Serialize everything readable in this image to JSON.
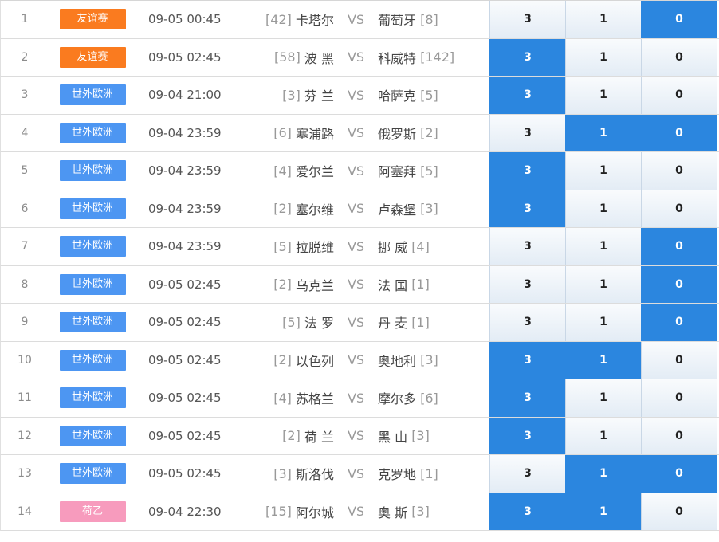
{
  "colors": {
    "league_friendly": "#fa7b1f",
    "league_wcq_europe": "#4d96f2",
    "league_eerste_divisie": "#f79bbd",
    "selected_option": "#2b86df"
  },
  "vs_label": "VS",
  "matches": [
    {
      "num": "1",
      "league": "友谊赛",
      "league_color": "#fa7b1f",
      "time": "09-05 00:45",
      "home_rank": "[42]",
      "home": "卡塔尔",
      "away": "葡萄牙",
      "away_rank": "[8]",
      "options": [
        {
          "label": "3",
          "selected": false
        },
        {
          "label": "1",
          "selected": false
        },
        {
          "label": "0",
          "selected": true
        }
      ]
    },
    {
      "num": "2",
      "league": "友谊赛",
      "league_color": "#fa7b1f",
      "time": "09-05 02:45",
      "home_rank": "[58]",
      "home": "波 黑",
      "away": "科威特",
      "away_rank": "[142]",
      "options": [
        {
          "label": "3",
          "selected": true
        },
        {
          "label": "1",
          "selected": false
        },
        {
          "label": "0",
          "selected": false
        }
      ]
    },
    {
      "num": "3",
      "league": "世外欧洲",
      "league_color": "#4d96f2",
      "time": "09-04 21:00",
      "home_rank": "[3]",
      "home": "芬 兰",
      "away": "哈萨克",
      "away_rank": "[5]",
      "options": [
        {
          "label": "3",
          "selected": true
        },
        {
          "label": "1",
          "selected": false
        },
        {
          "label": "0",
          "selected": false
        }
      ]
    },
    {
      "num": "4",
      "league": "世外欧洲",
      "league_color": "#4d96f2",
      "time": "09-04 23:59",
      "home_rank": "[6]",
      "home": "塞浦路",
      "away": "俄罗斯",
      "away_rank": "[2]",
      "options": [
        {
          "label": "3",
          "selected": false
        },
        {
          "label": "1",
          "selected": true
        },
        {
          "label": "0",
          "selected": true
        }
      ]
    },
    {
      "num": "5",
      "league": "世外欧洲",
      "league_color": "#4d96f2",
      "time": "09-04 23:59",
      "home_rank": "[4]",
      "home": "爱尔兰",
      "away": "阿塞拜",
      "away_rank": "[5]",
      "options": [
        {
          "label": "3",
          "selected": true
        },
        {
          "label": "1",
          "selected": false
        },
        {
          "label": "0",
          "selected": false
        }
      ]
    },
    {
      "num": "6",
      "league": "世外欧洲",
      "league_color": "#4d96f2",
      "time": "09-04 23:59",
      "home_rank": "[2]",
      "home": "塞尔维",
      "away": "卢森堡",
      "away_rank": "[3]",
      "options": [
        {
          "label": "3",
          "selected": true
        },
        {
          "label": "1",
          "selected": false
        },
        {
          "label": "0",
          "selected": false
        }
      ]
    },
    {
      "num": "7",
      "league": "世外欧洲",
      "league_color": "#4d96f2",
      "time": "09-04 23:59",
      "home_rank": "[5]",
      "home": "拉脱维",
      "away": "挪 威",
      "away_rank": "[4]",
      "options": [
        {
          "label": "3",
          "selected": false
        },
        {
          "label": "1",
          "selected": false
        },
        {
          "label": "0",
          "selected": true
        }
      ]
    },
    {
      "num": "8",
      "league": "世外欧洲",
      "league_color": "#4d96f2",
      "time": "09-05 02:45",
      "home_rank": "[2]",
      "home": "乌克兰",
      "away": "法 国",
      "away_rank": "[1]",
      "options": [
        {
          "label": "3",
          "selected": false
        },
        {
          "label": "1",
          "selected": false
        },
        {
          "label": "0",
          "selected": true
        }
      ]
    },
    {
      "num": "9",
      "league": "世外欧洲",
      "league_color": "#4d96f2",
      "time": "09-05 02:45",
      "home_rank": "[5]",
      "home": "法 罗",
      "away": "丹 麦",
      "away_rank": "[1]",
      "options": [
        {
          "label": "3",
          "selected": false
        },
        {
          "label": "1",
          "selected": false
        },
        {
          "label": "0",
          "selected": true
        }
      ]
    },
    {
      "num": "10",
      "league": "世外欧洲",
      "league_color": "#4d96f2",
      "time": "09-05 02:45",
      "home_rank": "[2]",
      "home": "以色列",
      "away": "奥地利",
      "away_rank": "[3]",
      "options": [
        {
          "label": "3",
          "selected": true
        },
        {
          "label": "1",
          "selected": true
        },
        {
          "label": "0",
          "selected": false
        }
      ]
    },
    {
      "num": "11",
      "league": "世外欧洲",
      "league_color": "#4d96f2",
      "time": "09-05 02:45",
      "home_rank": "[4]",
      "home": "苏格兰",
      "away": "摩尔多",
      "away_rank": "[6]",
      "options": [
        {
          "label": "3",
          "selected": true
        },
        {
          "label": "1",
          "selected": false
        },
        {
          "label": "0",
          "selected": false
        }
      ]
    },
    {
      "num": "12",
      "league": "世外欧洲",
      "league_color": "#4d96f2",
      "time": "09-05 02:45",
      "home_rank": "[2]",
      "home": "荷 兰",
      "away": "黑 山",
      "away_rank": "[3]",
      "options": [
        {
          "label": "3",
          "selected": true
        },
        {
          "label": "1",
          "selected": false
        },
        {
          "label": "0",
          "selected": false
        }
      ]
    },
    {
      "num": "13",
      "league": "世外欧洲",
      "league_color": "#4d96f2",
      "time": "09-05 02:45",
      "home_rank": "[3]",
      "home": "斯洛伐",
      "away": "克罗地",
      "away_rank": "[1]",
      "options": [
        {
          "label": "3",
          "selected": false
        },
        {
          "label": "1",
          "selected": true
        },
        {
          "label": "0",
          "selected": true
        }
      ]
    },
    {
      "num": "14",
      "league": "荷乙",
      "league_color": "#f79bbd",
      "time": "09-04 22:30",
      "home_rank": "[15]",
      "home": "阿尔城",
      "away": "奥 斯",
      "away_rank": "[3]",
      "options": [
        {
          "label": "3",
          "selected": true
        },
        {
          "label": "1",
          "selected": true
        },
        {
          "label": "0",
          "selected": false
        }
      ]
    }
  ]
}
